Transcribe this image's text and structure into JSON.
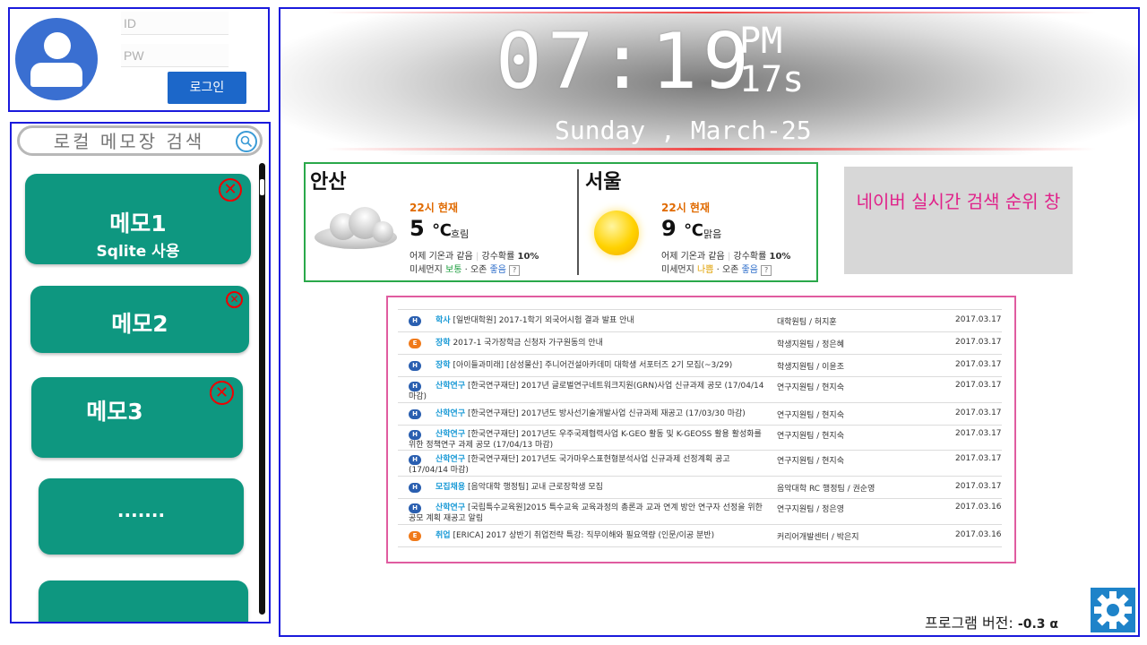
{
  "login": {
    "id_placeholder": "ID",
    "pw_placeholder": "PW",
    "login_button": "로그인"
  },
  "memo": {
    "search_placeholder": "로컬 메모장 검색",
    "items": [
      {
        "title": "메모1",
        "subtitle": "Sqlite 사용"
      },
      {
        "title": "메모2",
        "subtitle": ""
      },
      {
        "title": "메모3",
        "subtitle": ""
      },
      {
        "title": ".......",
        "subtitle": ""
      },
      {
        "title": "",
        "subtitle": ""
      }
    ]
  },
  "clock": {
    "time": "07:19",
    "ampm": "PM",
    "seconds": "17s",
    "date": "Sunday , March-25"
  },
  "weather": [
    {
      "city": "안산",
      "now": "22시 현재",
      "temp": "5",
      "unit": "℃",
      "condition": "흐림",
      "yesterday": "어제 기온과 같음",
      "rain_label": "강수확률",
      "rain": "10%",
      "dust_label": "미세먼지",
      "dust": "보통",
      "ozone_label": "오존",
      "ozone": "좋음",
      "icon": "cloud-icon"
    },
    {
      "city": "서울",
      "now": "22시 현재",
      "temp": "9",
      "unit": "℃",
      "condition": "맑음",
      "yesterday": "어제 기온과 같음",
      "rain_label": "강수확률",
      "rain": "10%",
      "dust_label": "미세먼지",
      "dust": "나쁨",
      "ozone_label": "오존",
      "ozone": "좋음",
      "icon": "sun-icon"
    }
  ],
  "naver": {
    "text": "네이버 실시간 검색 순위 창"
  },
  "notices": [
    {
      "badge": "H",
      "badge_color": "#2a5fb0",
      "category": "학사",
      "title": "[일반대학원] 2017-1학기 외국어시험 결과 발표 안내",
      "author": "대학원팀 / 허지훈",
      "date": "2017.03.17"
    },
    {
      "badge": "E",
      "badge_color": "#f07a1a",
      "category": "장학",
      "title": "2017-1 국가장학금 신청자 가구원동의 안내",
      "author": "학생지원팀 / 정은혜",
      "date": "2017.03.17"
    },
    {
      "badge": "H",
      "badge_color": "#2a5fb0",
      "category": "장학",
      "title": "[아이들과미래] [삼성물산] 주니어건설아카데미 대학생 서포터즈 2기 모집(~3/29)",
      "author": "학생지원팀 / 이윤조",
      "date": "2017.03.17"
    },
    {
      "badge": "H",
      "badge_color": "#2a5fb0",
      "category": "산학연구",
      "title": "[한국연구재단] 2017년 글로벌연구네트워크지원(GRN)사업 신규과제 공모 (17/04/14 마감)",
      "author": "연구지원팀 / 현지숙",
      "date": "2017.03.17"
    },
    {
      "badge": "H",
      "badge_color": "#2a5fb0",
      "category": "산학연구",
      "title": "[한국연구재단] 2017년도 방사선기술개발사업 신규과제 재공고 (17/03/30 마감)",
      "author": "연구지원팀 / 현지숙",
      "date": "2017.03.17"
    },
    {
      "badge": "H",
      "badge_color": "#2a5fb0",
      "category": "산학연구",
      "title": "[한국연구재단] 2017년도 우주국제협력사업 K-GEO 활동 및 K-GEOSS 활용 활성화를 위한 정책연구 과제 공모 (17/04/13 마감)",
      "author": "연구지원팀 / 현지숙",
      "date": "2017.03.17"
    },
    {
      "badge": "H",
      "badge_color": "#2a5fb0",
      "category": "산학연구",
      "title": "[한국연구재단] 2017년도 국가마우스표현형분석사업 신규과제 선정계획 공고 (17/04/14 마감)",
      "author": "연구지원팀 / 현지숙",
      "date": "2017.03.17"
    },
    {
      "badge": "H",
      "badge_color": "#2a5fb0",
      "category": "모집채용",
      "title": "[음악대학 행정팀] 교내 근로장학생 모집",
      "author": "음악대학 RC 행정팀 / 권순영",
      "date": "2017.03.17"
    },
    {
      "badge": "H",
      "badge_color": "#2a5fb0",
      "category": "산학연구",
      "title": "[국립특수교육원]2015 특수교육 교육과정의 총론과 교과 연계 방안 연구자 선정을 위한 공모 계획 재공고 알림",
      "author": "연구지원팀 / 정은영",
      "date": "2017.03.16"
    },
    {
      "badge": "E",
      "badge_color": "#f07a1a",
      "category": "취업",
      "title": "[ERICA] 2017 상반기 취업전략 특강: 직무이해와 필요역량 (인문/이공 분반)",
      "author": "커리어개발센터 / 박은지",
      "date": "2017.03.16"
    }
  ],
  "footer": {
    "version_label": "프로그램 버전:",
    "version_value": "-0.3 α"
  }
}
